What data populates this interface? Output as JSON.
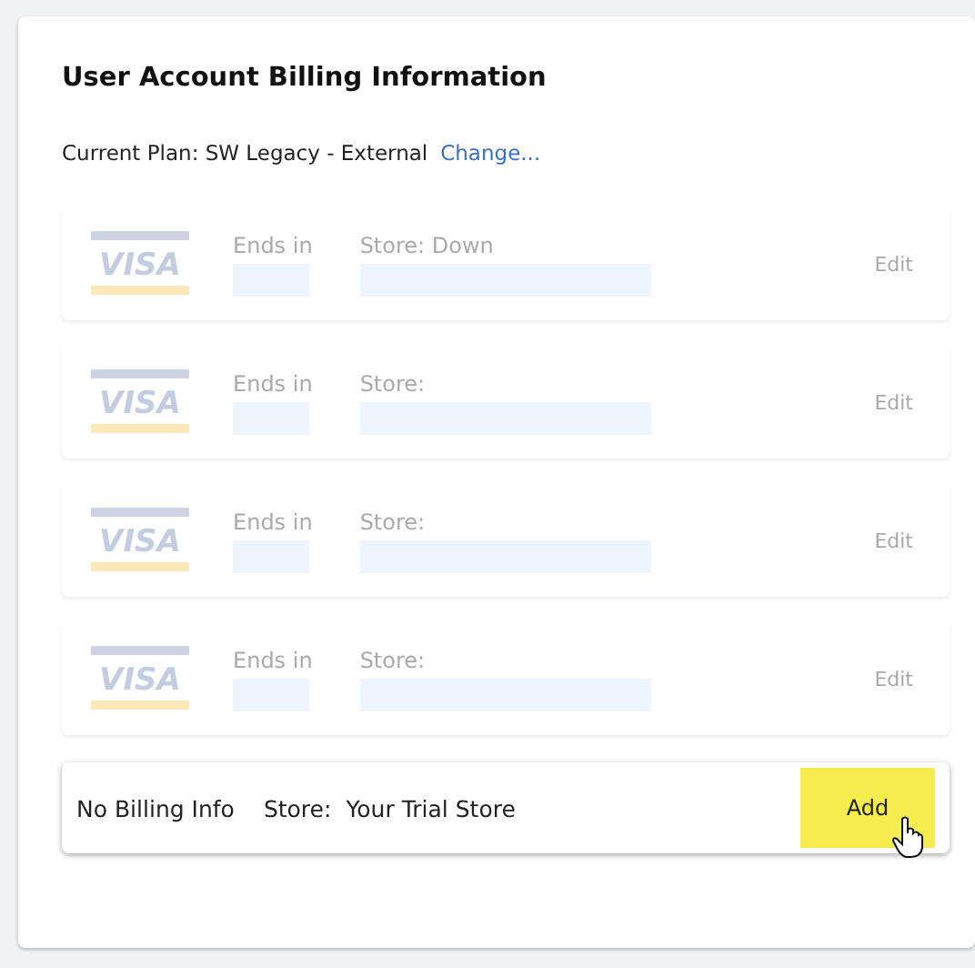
{
  "title": "User Account Billing Information",
  "plan": {
    "label": "Current Plan: SW Legacy - External",
    "link": "Change..."
  },
  "cards": [
    {
      "brand": "VISA",
      "ends_label": "Ends in",
      "store_label": "Store: Down",
      "action": "Edit"
    },
    {
      "brand": "VISA",
      "ends_label": "Ends in",
      "store_label": "Store:",
      "action": "Edit"
    },
    {
      "brand": "VISA",
      "ends_label": "Ends in",
      "store_label": "Store:",
      "action": "Edit"
    },
    {
      "brand": "VISA",
      "ends_label": "Ends in",
      "store_label": "Store:",
      "action": "Edit"
    }
  ],
  "empty_row": {
    "status": "No Billing Info",
    "store_label": "Store:",
    "store_value": "Your Trial Store",
    "action": "Add",
    "highlighted": true
  }
}
